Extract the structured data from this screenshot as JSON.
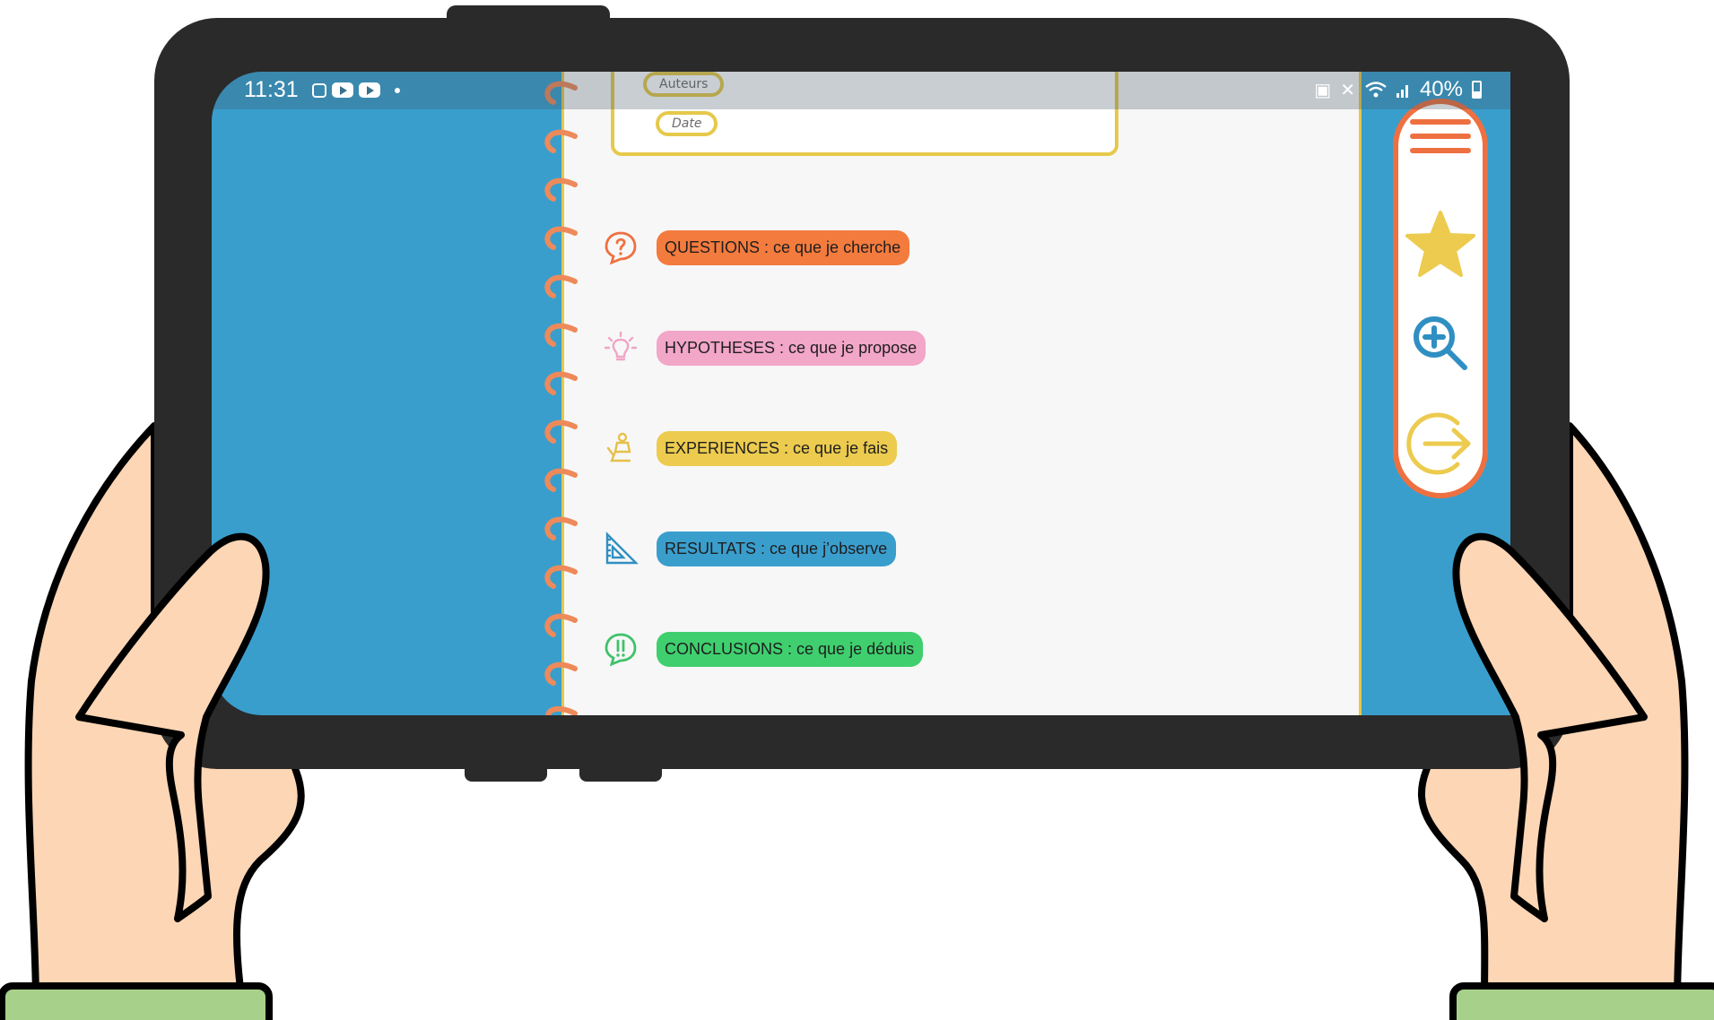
{
  "colors": {
    "screen_blue": "#3a9ecd",
    "orange": "#f47b3e",
    "pink": "#f2a6c8",
    "yellow": "#eccb4f",
    "blue": "#3a9ecd",
    "green": "#3fcf6e",
    "accent_orange": "#ee7040"
  },
  "status_bar": {
    "time": "11:31",
    "battery": "40%",
    "icons_left": [
      "instagram-icon",
      "youtube-icon",
      "youtube-icon",
      "dot-icon"
    ],
    "icons_right": [
      "battery-saver-icon",
      "mute-icon",
      "wifi-icon",
      "signal-icon",
      "battery-icon"
    ]
  },
  "notebook": {
    "authors_label": "Auteurs",
    "date_label": "Date",
    "rows": [
      {
        "label": "QUESTIONS : ce que je cherche",
        "icon": "question-bubble-icon"
      },
      {
        "label": "HYPOTHESES : ce que je propose",
        "icon": "lightbulb-icon"
      },
      {
        "label": "EXPERIENCES : ce que je fais",
        "icon": "experiment-person-icon"
      },
      {
        "label": "RESULTATS : ce que j’observe",
        "icon": "ruler-square-icon"
      },
      {
        "label": "CONCLUSIONS : ce que je déduis",
        "icon": "exclamation-bubble-icon"
      }
    ]
  },
  "sidebar": {
    "items": [
      "menu-icon",
      "star-icon",
      "zoom-in-icon",
      "exit-arrow-icon"
    ]
  }
}
